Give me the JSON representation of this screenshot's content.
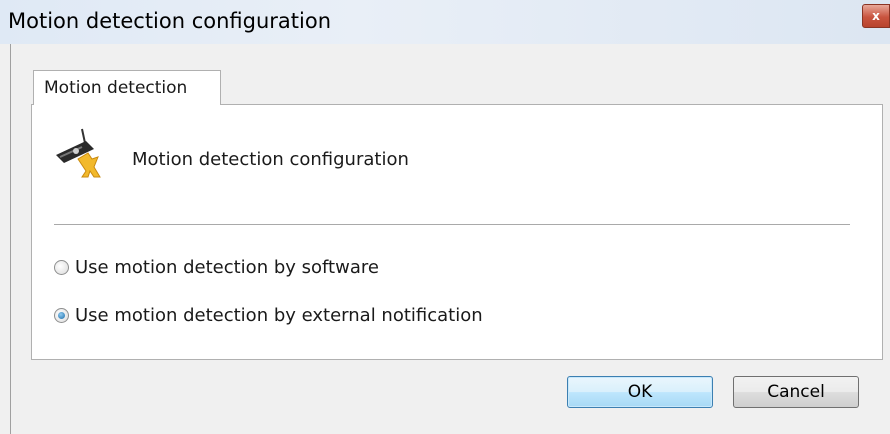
{
  "window": {
    "title": "Motion detection configuration",
    "close_glyph": "x"
  },
  "tabs": [
    {
      "label": "Motion detection",
      "selected": true
    }
  ],
  "panel": {
    "icon": "security-camera-icon",
    "header": "Motion detection configuration"
  },
  "options": [
    {
      "label": "Use motion detection by software",
      "checked": false
    },
    {
      "label": "Use motion detection by external notification",
      "checked": true
    }
  ],
  "buttons": {
    "ok_label": "OK",
    "cancel_label": "Cancel"
  },
  "colors": {
    "accent": "#3c7fb1",
    "close": "#c9543f",
    "icon_yellow": "#f2b92b"
  }
}
